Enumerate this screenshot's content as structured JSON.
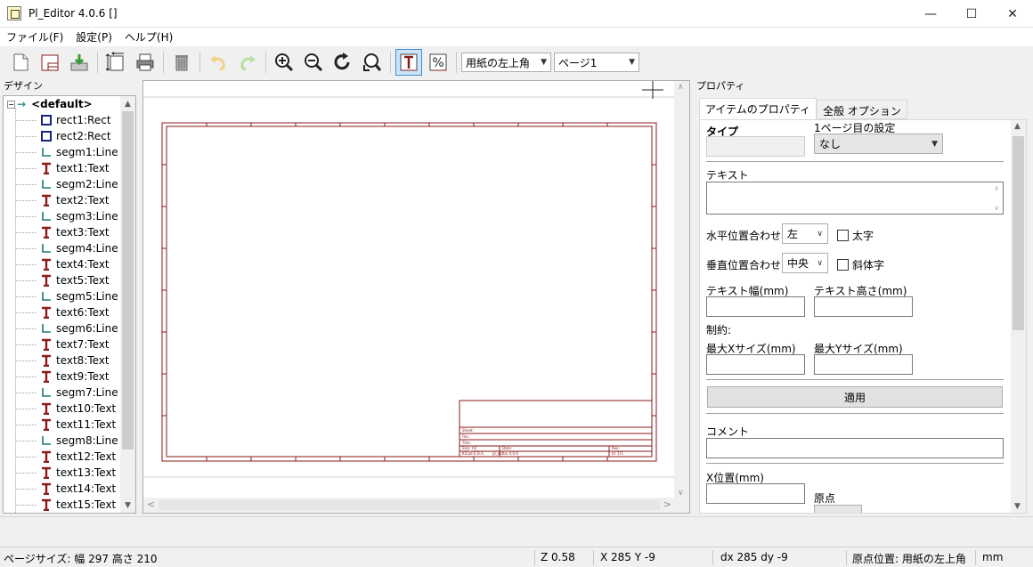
{
  "window": {
    "title": "Pl_Editor 4.0.6 []",
    "controls": {
      "minimize": "—",
      "maximize": "☐",
      "close": "✕"
    }
  },
  "menu": [
    "ファイル(F)",
    "設定(P)",
    "ヘルプ(H)"
  ],
  "toolbar": {
    "page_position_select": "用紙の左上角",
    "page_select": "ページ1"
  },
  "left_panel": {
    "title": "デザイン",
    "root": "<default>",
    "items": [
      {
        "label": "rect1:Rect",
        "kind": "rect"
      },
      {
        "label": "rect2:Rect",
        "kind": "rect"
      },
      {
        "label": "segm1:Line",
        "kind": "line"
      },
      {
        "label": "text1:Text",
        "kind": "text"
      },
      {
        "label": "segm2:Line",
        "kind": "line"
      },
      {
        "label": "text2:Text",
        "kind": "text"
      },
      {
        "label": "segm3:Line",
        "kind": "line"
      },
      {
        "label": "text3:Text",
        "kind": "text"
      },
      {
        "label": "segm4:Line",
        "kind": "line"
      },
      {
        "label": "text4:Text",
        "kind": "text"
      },
      {
        "label": "text5:Text",
        "kind": "text"
      },
      {
        "label": "segm5:Line",
        "kind": "line"
      },
      {
        "label": "text6:Text",
        "kind": "text"
      },
      {
        "label": "segm6:Line",
        "kind": "line"
      },
      {
        "label": "text7:Text",
        "kind": "text"
      },
      {
        "label": "text8:Text",
        "kind": "text"
      },
      {
        "label": "text9:Text",
        "kind": "text"
      },
      {
        "label": "segm7:Line",
        "kind": "line"
      },
      {
        "label": "text10:Text",
        "kind": "text"
      },
      {
        "label": "text11:Text",
        "kind": "text"
      },
      {
        "label": "segm8:Line",
        "kind": "line"
      },
      {
        "label": "text12:Text",
        "kind": "text"
      },
      {
        "label": "text13:Text",
        "kind": "text"
      },
      {
        "label": "text14:Text",
        "kind": "text"
      },
      {
        "label": "text15:Text",
        "kind": "text"
      }
    ]
  },
  "right_panel": {
    "title": "プロパティ",
    "tabs": [
      "アイテムのプロパティ",
      "全般 オプション"
    ],
    "type_label": "タイプ",
    "first_page_label": "1ページ目の設定",
    "first_page_value": "なし",
    "text_label": "テキスト",
    "halign_label": "水平位置合わせ",
    "halign_value": "左",
    "bold_label": "太字",
    "valign_label": "垂直位置合わせ",
    "valign_value": "中央",
    "italic_label": "斜体字",
    "text_width_label": "テキスト幅(mm)",
    "text_height_label": "テキスト高さ(mm)",
    "constraint_label": "制約:",
    "max_x_label": "最大Xサイズ(mm)",
    "max_y_label": "最大Yサイズ(mm)",
    "apply_button": "適用",
    "comment_label": "コメント",
    "x_pos_label": "X位置(mm)",
    "origin_label": "原点"
  },
  "title_block": {
    "rows": [
      "Sheet:",
      "File:",
      "Title:"
    ],
    "row1_left": "Size: A4",
    "row1_mid": "Date:",
    "row1_right": "Rev:",
    "row2_left": "KiCad E.D.A.",
    "row2_mid": "pl_editor 4.0.6",
    "row2_right": "Id: 1/1"
  },
  "status": {
    "page_size": "ページサイズ: 幅 297 高さ 210",
    "zoom": "Z 0.58",
    "xy": "X 285  Y -9",
    "dxdy": "dx 285  dy -9",
    "origin": "原点位置: 用紙の左上角",
    "unit": "mm"
  },
  "colors": {
    "sheet_line": "#8b1a1a",
    "accent": "#3b8fd8"
  }
}
